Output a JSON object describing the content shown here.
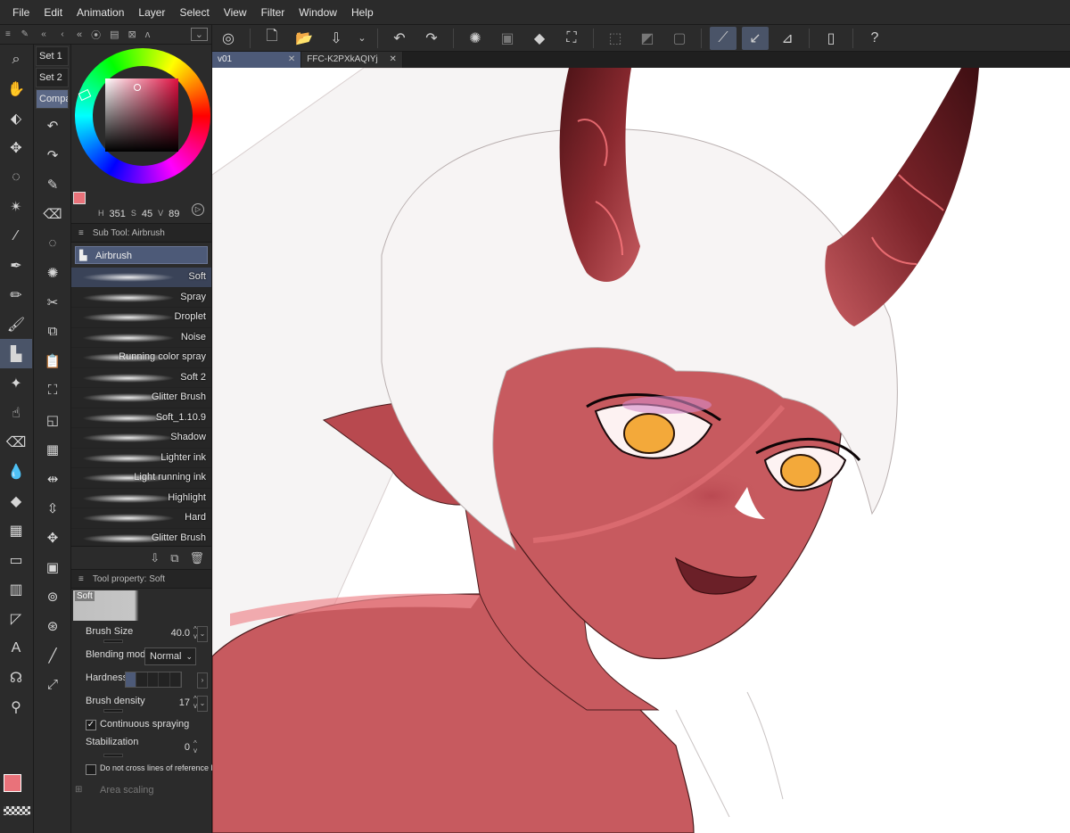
{
  "menu": [
    "File",
    "Edit",
    "Animation",
    "Layer",
    "Select",
    "View",
    "Filter",
    "Window",
    "Help"
  ],
  "tool_sets": [
    "Set 1",
    "Set 2",
    "Compa"
  ],
  "color": {
    "main": "#e9727a",
    "sub": "#777777",
    "h_label": "H",
    "h_value": "351",
    "s_label": "S",
    "s_value": "45",
    "v_label": "V",
    "v_value": "89"
  },
  "sub_tool": {
    "header": "Sub Tool: Airbrush",
    "group": "Airbrush",
    "brushes": [
      "Soft",
      "Spray",
      "Droplet",
      "Noise",
      "Running color spray",
      "Soft 2",
      "Glitter Brush",
      "Soft_1.10.9",
      "Shadow",
      "Lighter ink",
      "Light running ink",
      "Highlight",
      "Hard",
      "Glitter Brush"
    ],
    "active_index": 0
  },
  "tool_property": {
    "header": "Tool property: Soft",
    "preview_label": "Soft",
    "brush_size_label": "Brush Size",
    "brush_size_value": "40.0",
    "blending_label": "Blending mode",
    "blending_value": "Normal",
    "hardness_label": "Hardness",
    "hardness_level": 1,
    "density_label": "Brush density",
    "density_value": "17",
    "continuous_label": "Continuous spraying",
    "continuous_checked": true,
    "stabilization_label": "Stabilization",
    "stabilization_value": "0",
    "cross_label": "Do not cross lines of reference la",
    "area_label": "Area scaling"
  },
  "tabs": [
    {
      "label": "v01",
      "close": "✕"
    },
    {
      "label": "FFC-K2PXkAQIYj",
      "close": "✕"
    }
  ],
  "palette": {
    "skin": "#c75a5f",
    "skin_shadow": "#a8434a",
    "horn": "#8c2a30",
    "horn_dark": "#4a1216",
    "hair": "#f7f4f4",
    "eye": "#f3a93a",
    "accent": "#4d5a78"
  }
}
